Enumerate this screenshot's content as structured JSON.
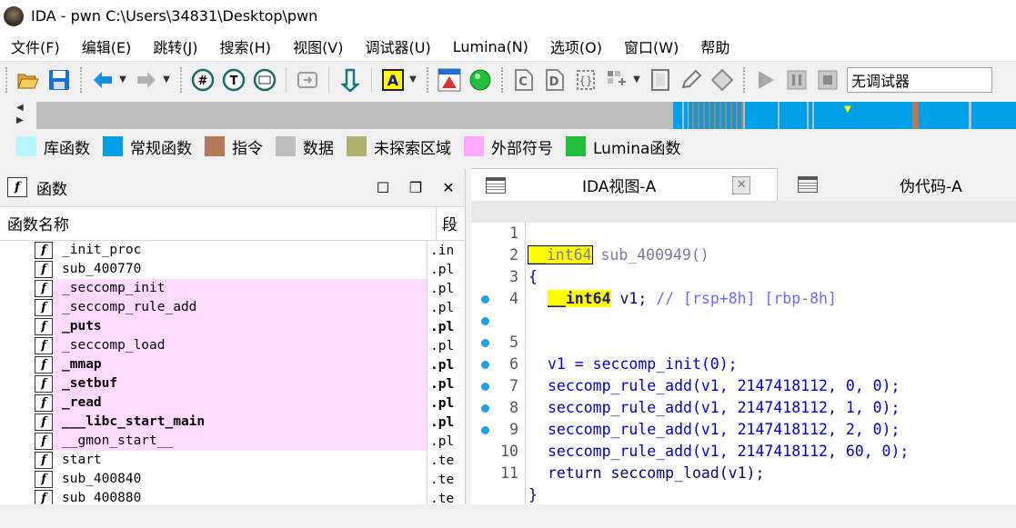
{
  "window": {
    "title": "IDA - pwn C:\\Users\\34831\\Desktop\\pwn"
  },
  "menu": [
    "文件(F)",
    "编辑(E)",
    "跳转(J)",
    "搜索(H)",
    "视图(V)",
    "调试器(U)",
    "Lumina(N)",
    "选项(O)",
    "窗口(W)",
    "帮助"
  ],
  "toolbar": {
    "debugger_select": "无调试器"
  },
  "legend": [
    {
      "label": "库函数",
      "color": "#b8f4ff"
    },
    {
      "label": "常规函数",
      "color": "#00a0e8"
    },
    {
      "label": "指令",
      "color": "#b47a5a"
    },
    {
      "label": "数据",
      "color": "#bdbdbd"
    },
    {
      "label": "未探索区域",
      "color": "#b0b070"
    },
    {
      "label": "外部符号",
      "color": "#ffa8ff"
    },
    {
      "label": "Lumina函数",
      "color": "#22c03a"
    }
  ],
  "functions_panel": {
    "title": "函数",
    "col_name": "函数名称",
    "col_segment": "段",
    "rows": [
      {
        "name": "_init_proc",
        "segment": ".init",
        "pink": false,
        "bold": false
      },
      {
        "name": "sub_400770",
        "segment": ".plt",
        "pink": false,
        "bold": false
      },
      {
        "name": "_seccomp_init",
        "segment": ".plt",
        "pink": true,
        "bold": false
      },
      {
        "name": "_seccomp_rule_add",
        "segment": ".plt",
        "pink": true,
        "bold": false
      },
      {
        "name": "_puts",
        "segment": ".plt",
        "pink": true,
        "bold": true
      },
      {
        "name": "_seccomp_load",
        "segment": ".plt",
        "pink": true,
        "bold": false
      },
      {
        "name": "_mmap",
        "segment": ".plt",
        "pink": true,
        "bold": true
      },
      {
        "name": "_setbuf",
        "segment": ".plt",
        "pink": true,
        "bold": true
      },
      {
        "name": "_read",
        "segment": ".plt",
        "pink": true,
        "bold": true
      },
      {
        "name": "___libc_start_main",
        "segment": ".plt",
        "pink": true,
        "bold": true
      },
      {
        "name": "__gmon_start__",
        "segment": ".plt",
        "pink": true,
        "bold": false
      },
      {
        "name": "start",
        "segment": ".text",
        "pink": false,
        "bold": false
      },
      {
        "name": "sub_400840",
        "segment": ".text",
        "pink": false,
        "bold": false
      },
      {
        "name": "sub_400880",
        "segment": ".text",
        "pink": false,
        "bold": false
      }
    ]
  },
  "tabs": {
    "ida_view": "IDA视图-A",
    "pseudocode": "伪代码-A",
    "close_glyph": "✕"
  },
  "code": {
    "l1": {
      "no": "1",
      "type": "__int64",
      "rest": " sub_400949()"
    },
    "l2": {
      "no": "2",
      "text": "{"
    },
    "l3": {
      "no": "3",
      "type": "__int64",
      "var": " v1;",
      "comment": " // [rsp+8h] [rbp-8h]"
    },
    "l4": {
      "no": "4"
    },
    "l5": {
      "no": "5",
      "text": "v1 = seccomp_init(0);"
    },
    "l6": {
      "no": "6",
      "text": "seccomp_rule_add(v1, 2147418112, 0, 0);"
    },
    "l7": {
      "no": "7",
      "text": "seccomp_rule_add(v1, 2147418112, 1, 0);"
    },
    "l8": {
      "no": "8",
      "text": "seccomp_rule_add(v1, 2147418112, 2, 0);"
    },
    "l9": {
      "no": "9",
      "text": "seccomp_rule_add(v1, 2147418112, 60, 0);"
    },
    "l10": {
      "no": "10",
      "text": "return seccomp_load(v1);"
    },
    "l11": {
      "no": "11",
      "text": "}"
    }
  }
}
